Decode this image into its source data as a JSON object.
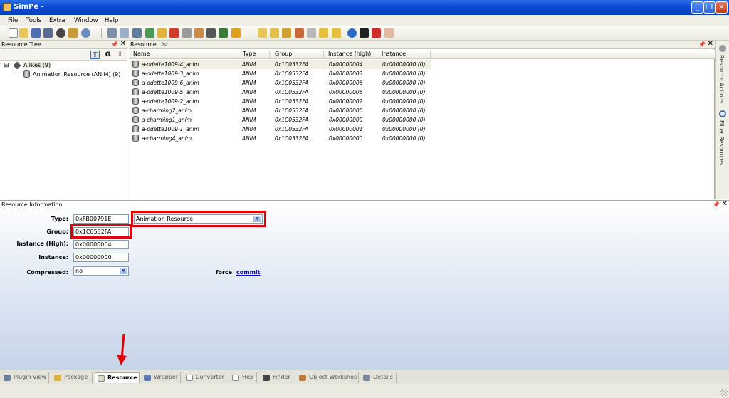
{
  "window": {
    "title": "SimPe -",
    "controls": {
      "minimize": "_",
      "maximize": "❐",
      "close": "✕"
    }
  },
  "menu": [
    "File",
    "Tools",
    "Extra",
    "Window",
    "Help"
  ],
  "tree": {
    "title": "Resource Tree",
    "sort_buttons": [
      "T",
      "G",
      "I"
    ],
    "root": {
      "expander": "⊟",
      "label": "AllRes (9)"
    },
    "child": {
      "label": "Animation Resource (ANIM) (9)"
    }
  },
  "list": {
    "title": "Resource List",
    "columns": [
      "Name",
      "Type",
      "Group",
      "Instance (high)",
      "Instance"
    ],
    "rows": [
      [
        "a-odette1009-4_anim",
        "ANIM",
        "0x1C0532FA",
        "0x00000004",
        "0x00000000 (0)"
      ],
      [
        "a-odette1009-3_anim",
        "ANIM",
        "0x1C0532FA",
        "0x00000003",
        "0x00000000 (0)"
      ],
      [
        "a-odette1009-6_anim",
        "ANIM",
        "0x1C0532FA",
        "0x00000006",
        "0x00000000 (0)"
      ],
      [
        "a-odette1009-5_anim",
        "ANIM",
        "0x1C0532FA",
        "0x00000005",
        "0x00000000 (0)"
      ],
      [
        "a-odette1009-2_anim",
        "ANIM",
        "0x1C0532FA",
        "0x00000002",
        "0x00000000 (0)"
      ],
      [
        "a-charming2_anim",
        "ANIM",
        "0x1C0532FA",
        "0x00000000",
        "0x00000000 (0)"
      ],
      [
        "a-charming1_anim",
        "ANIM",
        "0x1C0532FA",
        "0x00000000",
        "0x00000000 (0)"
      ],
      [
        "a-odette1009-1_anim",
        "ANIM",
        "0x1C0532FA",
        "0x00000001",
        "0x00000000 (0)"
      ],
      [
        "a-charming4_anim",
        "ANIM",
        "0x1C0532FA",
        "0x00000000",
        "0x00000000 (0)"
      ]
    ]
  },
  "sidebar": {
    "actions": "Resource Actions",
    "filter": "Filter Resources"
  },
  "info": {
    "title": "Resource Information",
    "type_label": "Type:",
    "type_value": "0xFB00791E",
    "type_select": "Animation Resource",
    "group_label": "Group:",
    "group_value": "0x1C0532FA",
    "inst_high_label": "Instance (High):",
    "inst_high_value": "0x00000004",
    "instance_label": "Instance:",
    "instance_value": "0x00000000",
    "compressed_label": "Compressed:",
    "compressed_value": "no",
    "force_text": "force",
    "commit_link": "commit"
  },
  "tabs": [
    "Plugin View",
    "Package",
    "Resource",
    "Wrapper",
    "Converter",
    "Hex",
    "Finder",
    "Object Workshop",
    "Details"
  ],
  "active_tab": "Resource",
  "colors": {
    "highlight": "#e00000",
    "titlebar": "#0b4bd4",
    "link": "#0000cc"
  }
}
